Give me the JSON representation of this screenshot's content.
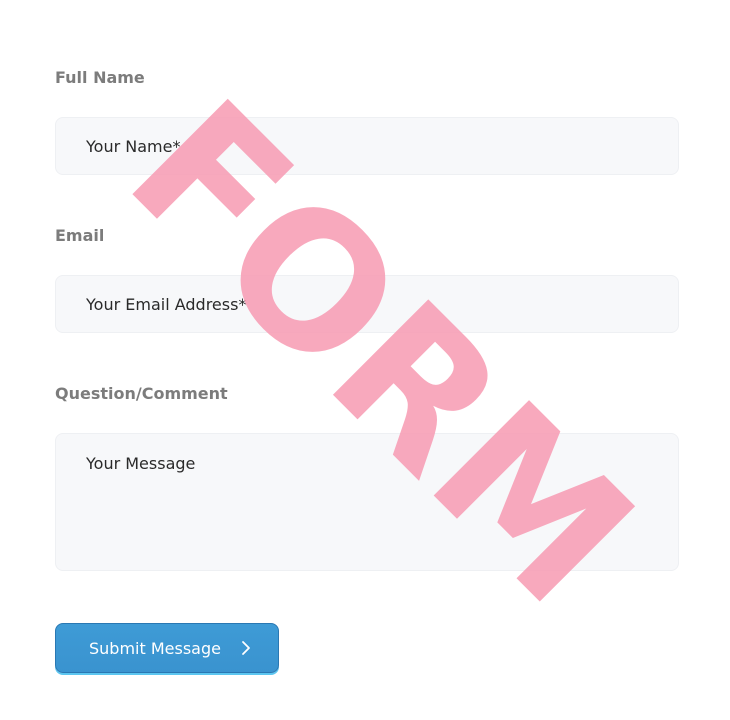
{
  "form": {
    "name_label": "Full Name",
    "name_placeholder": "Your Name*",
    "email_label": "Email",
    "email_placeholder": "Your Email Address*",
    "message_label": "Question/Comment",
    "message_placeholder": "Your Message",
    "submit_label": "Submit Message",
    "submit_icon": "chevron-right-icon"
  },
  "watermark": {
    "text": "FORM",
    "color": "#f79ab2"
  },
  "colors": {
    "accent": "#3e9bd6",
    "field_background": "#f7f8fa",
    "label": "#7c7c7c"
  }
}
